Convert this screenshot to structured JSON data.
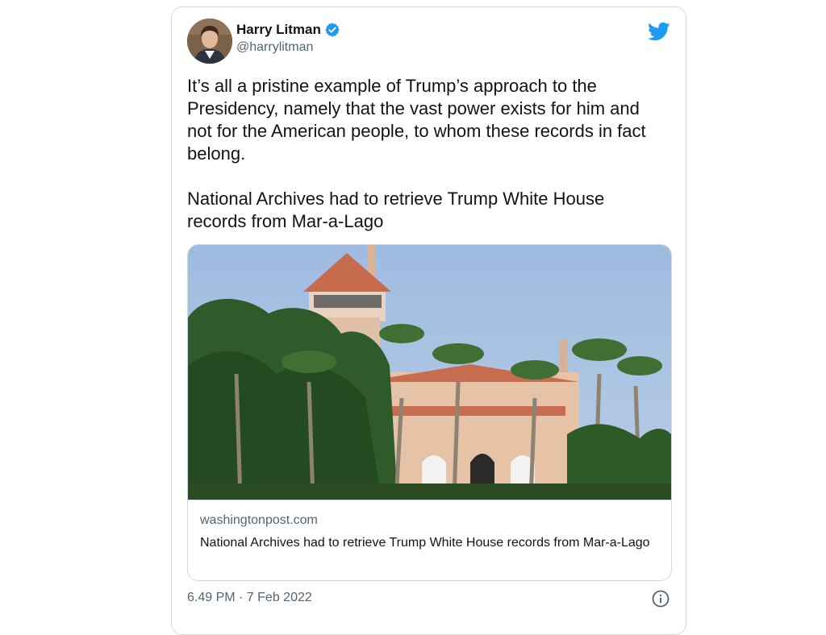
{
  "tweet": {
    "author_name": "Harry Litman",
    "author_handle": "@harrylitman",
    "verified": true,
    "paragraphs": [
      "It’s all a pristine example of Trump’s approach to the Presidency, namely that the vast power exists for him and not for the American people, to whom these records in fact belong.",
      "National Archives had to retrieve Trump White House records from Mar-a-Lago"
    ],
    "timestamp": "6.49 PM · 7 Feb 2022"
  },
  "link_card": {
    "domain": "washingtonpost.com",
    "title": "National Archives had to retrieve Trump White House records from Mar-a-Lago"
  },
  "icons": {
    "brand": "twitter-bird-icon",
    "verified": "verified-badge-icon",
    "info": "info-icon"
  },
  "colors": {
    "twitter_blue": "#1d9bf0",
    "text": "#0f1419",
    "secondary_text": "#536471",
    "border": "#cfd9de"
  }
}
